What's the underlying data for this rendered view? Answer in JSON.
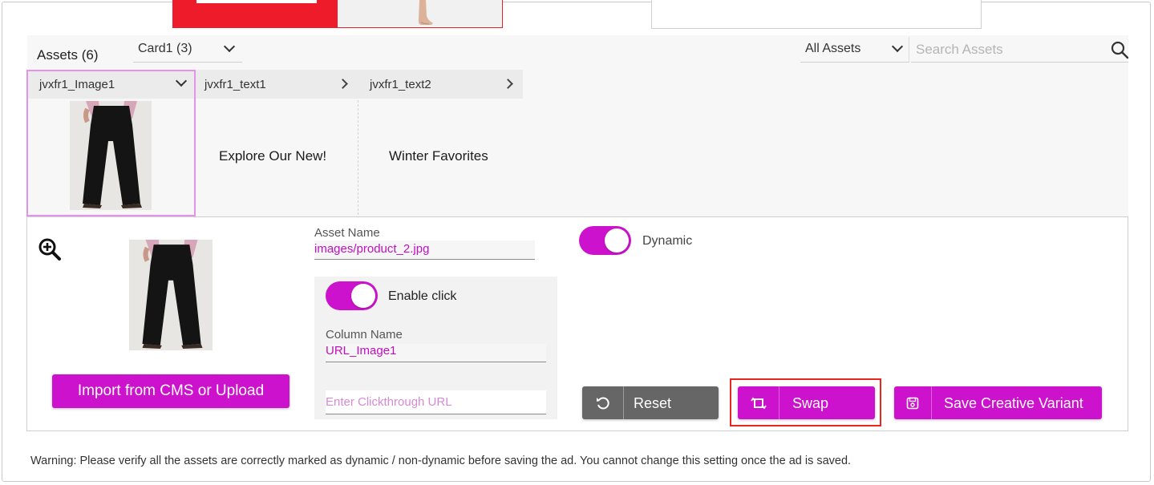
{
  "assets": {
    "title": "Assets (6)",
    "card_select": "Card1 (3)",
    "filter_select": "All Assets",
    "search_placeholder": "Search Assets",
    "tabs": [
      {
        "label": "jvxfr1_Image1",
        "expanded": true
      },
      {
        "label": "jvxfr1_text1",
        "expanded": false
      },
      {
        "label": "jvxfr1_text2",
        "expanded": false
      }
    ],
    "cells": [
      {
        "type": "image",
        "icon": "black-pants-product-image"
      },
      {
        "type": "text",
        "value": "Explore Our New!"
      },
      {
        "type": "text",
        "value": "Winter Favorites"
      }
    ]
  },
  "editor": {
    "import_button": "Import from CMS or Upload",
    "asset_name_label": "Asset Name",
    "asset_name_value": "images/product_2.jpg",
    "enable_click_label": "Enable click",
    "enable_click_on": true,
    "column_name_label": "Column Name",
    "column_name_value": "URL_Image1",
    "clickthrough_placeholder": "Enter Clickthrough URL",
    "dynamic_label": "Dynamic",
    "dynamic_on": true,
    "reset_button": "Reset",
    "swap_button": "Swap",
    "save_button": "Save Creative Variant"
  },
  "warning": "Warning: Please verify all the assets are correctly marked as dynamic / non-dynamic before saving the ad. You cannot change this setting once the ad is saved.",
  "colors": {
    "accent": "#cc12cc",
    "reset_gray": "#666666",
    "highlight_red": "#e8281e",
    "selection_pink": "#e592ec",
    "brand_red": "#ee1c2b"
  }
}
